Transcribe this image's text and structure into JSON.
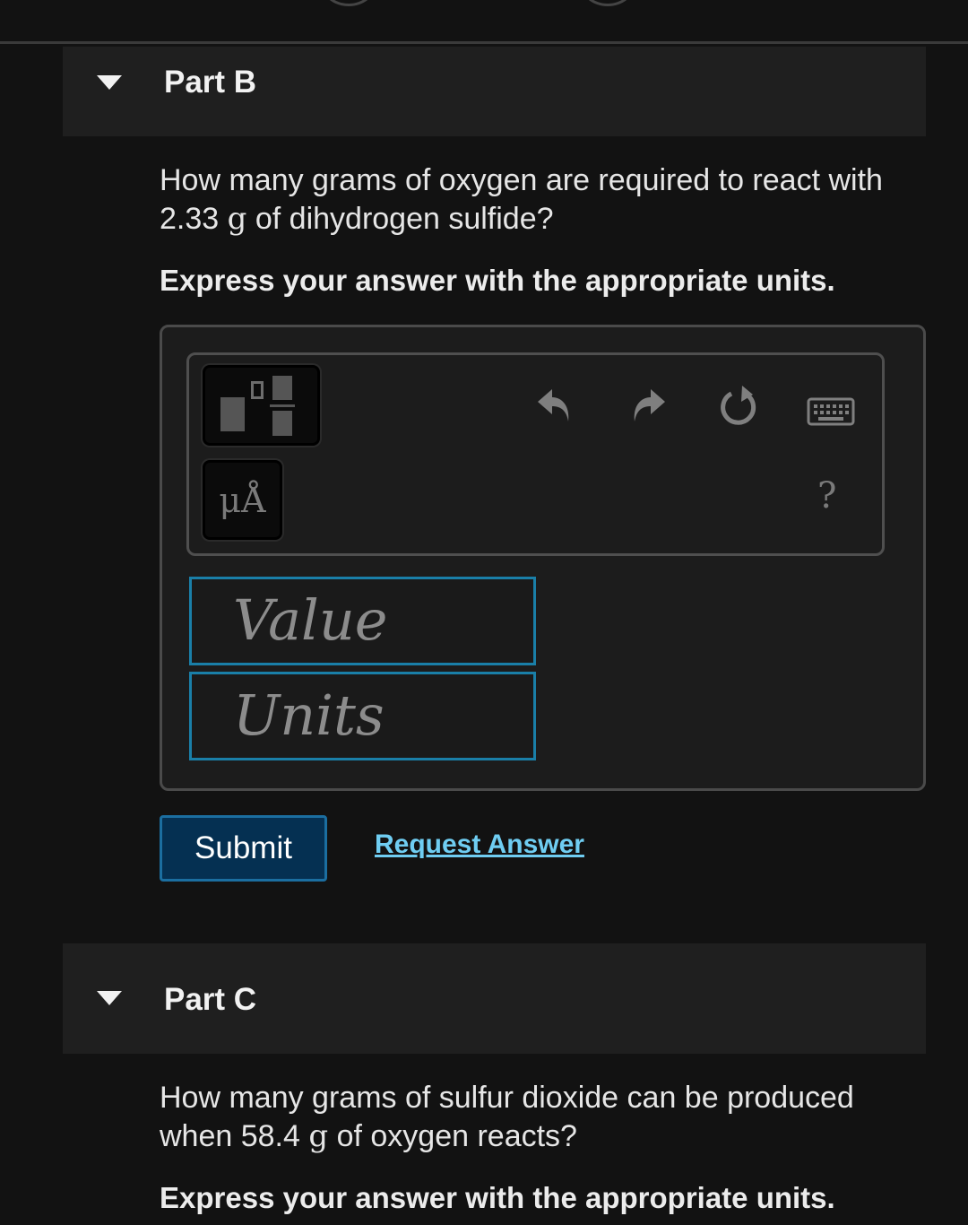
{
  "parts": [
    {
      "title": "Part B",
      "question_before": "How many grams of oxygen are required to react with",
      "question_value": "2.33",
      "question_unit": "g",
      "question_after": "of dihydrogen sulfide?",
      "instruction": "Express your answer with the appropriate units."
    },
    {
      "title": "Part C",
      "question_before": "How many grams of sulfur dioxide can be produced",
      "question_value": "when 58.4",
      "question_unit": "g",
      "question_after": "of oxygen reacts?",
      "instruction": "Express your answer with the appropriate units."
    }
  ],
  "toolbar": {
    "units_label": "μÅ",
    "help_label": "?",
    "icons": [
      "templates-icon",
      "units-icon",
      "undo-icon",
      "redo-icon",
      "reset-icon",
      "keyboard-icon",
      "help-icon"
    ]
  },
  "answer": {
    "value_placeholder": "Value",
    "units_placeholder": "Units"
  },
  "actions": {
    "submit_label": "Submit",
    "request_answer_label": "Request Answer"
  },
  "colors": {
    "background": "#121212",
    "panel": "#1f1f1f",
    "field_border": "#1a7fa8",
    "submit_bg": "#053052",
    "link": "#6fcdf2"
  }
}
